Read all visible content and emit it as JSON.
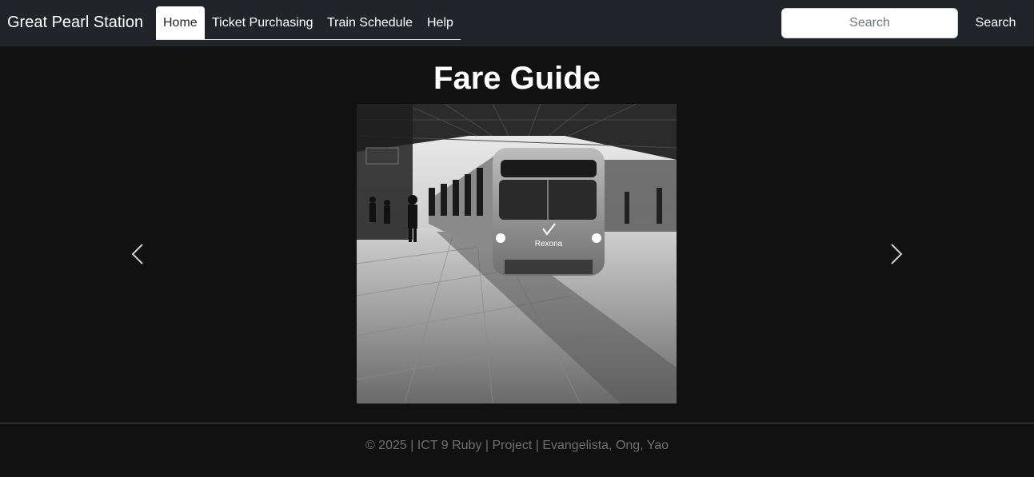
{
  "navbar": {
    "brand": "Great Pearl Station",
    "tabs": [
      {
        "label": "Home",
        "active": true
      },
      {
        "label": "Ticket Purchasing",
        "active": false
      },
      {
        "label": "Train Schedule",
        "active": false
      },
      {
        "label": "Help",
        "active": false
      }
    ],
    "search": {
      "placeholder": "Search",
      "value": "",
      "button_label": "Search"
    }
  },
  "main": {
    "title": "Fare Guide",
    "carousel": {
      "image": "train-platform-photo",
      "train_logo_text": "Rexona",
      "prev_icon": "chevron-left-icon",
      "next_icon": "chevron-right-icon"
    }
  },
  "footer": {
    "text": "© 2025 | ICT 9 Ruby | Project | Evangelista, Ong, Yao"
  },
  "colors": {
    "navbar_bg": "#212529",
    "page_bg": "#111111",
    "footer_text": "#6c6f73",
    "active_tab_bg": "#ffffff"
  }
}
